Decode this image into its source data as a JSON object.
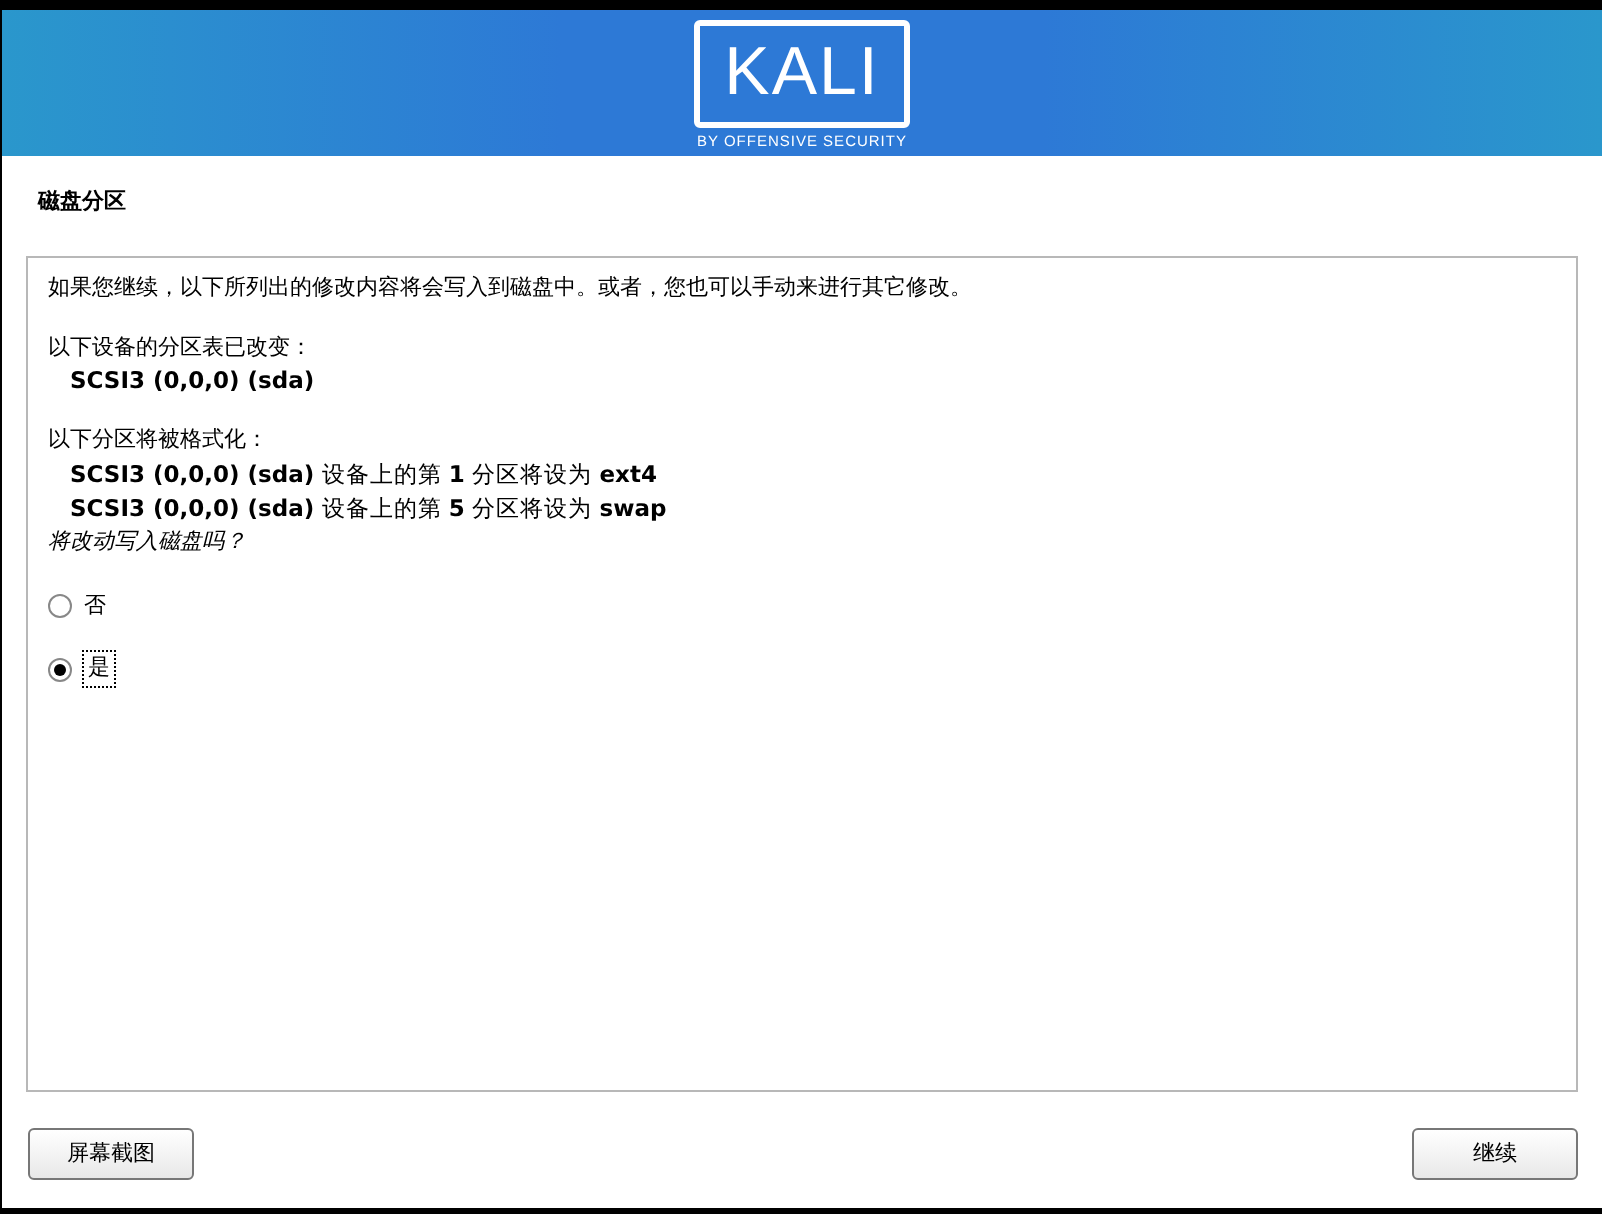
{
  "banner": {
    "logo": "KALI",
    "tagline": "BY OFFENSIVE SECURITY"
  },
  "title": "磁盘分区",
  "intro": "如果您继续，以下所列出的修改内容将会写入到磁盘中。或者，您也可以手动来进行其它修改。",
  "sections": [
    {
      "kind": "devices",
      "heading": "以下设备的分区表已改变：",
      "items": [
        "SCSI3 (0,0,0) (sda)"
      ]
    },
    {
      "kind": "partitions",
      "heading": "以下分区将被格式化：",
      "items": [
        "**SCSI3 (0,0,0) (sda)** 设备上的第 **1** 分区将设为 **ext4**",
        "**SCSI3 (0,0,0) (sda)** 设备上的第 **5** 分区将设为 **swap**"
      ]
    }
  ],
  "question": "将改动写入磁盘吗？",
  "options": [
    {
      "label": "否",
      "selected": false
    },
    {
      "label": "是",
      "selected": true
    }
  ],
  "buttons": {
    "left": "屏幕截图",
    "right": "继续"
  }
}
